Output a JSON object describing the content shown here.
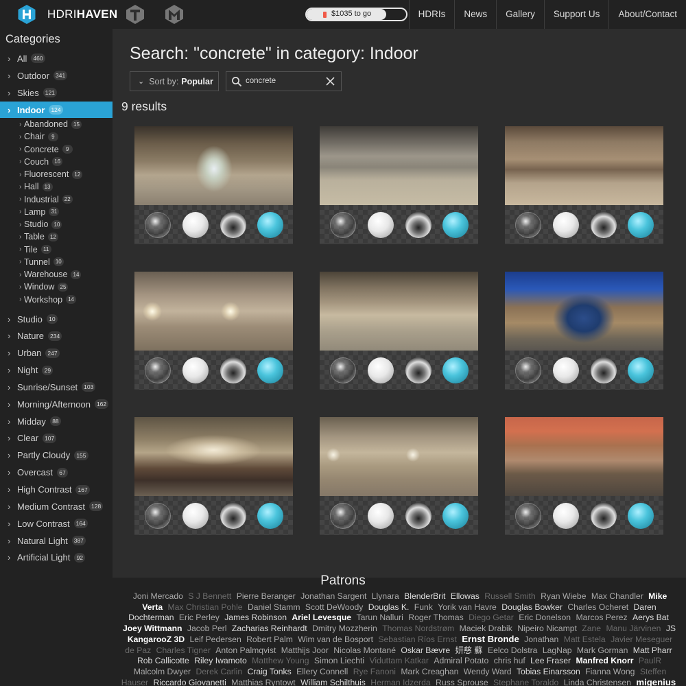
{
  "header": {
    "logo_light": "HDRI",
    "logo_bold_part": "HAVEN",
    "goal_text": "$1035 to go",
    "goal_progress": 0.8,
    "nav": [
      "HDRIs",
      "News",
      "Gallery",
      "Support Us",
      "About/Contact"
    ]
  },
  "sidebar": {
    "title": "Categories",
    "categories": [
      {
        "label": "All",
        "count": "460"
      },
      {
        "label": "Outdoor",
        "count": "341"
      },
      {
        "label": "Skies",
        "count": "121"
      },
      {
        "label": "Indoor",
        "count": "124"
      },
      {
        "label": "Studio",
        "count": "10"
      },
      {
        "label": "Nature",
        "count": "234"
      },
      {
        "label": "Urban",
        "count": "247"
      },
      {
        "label": "Night",
        "count": "29"
      },
      {
        "label": "Sunrise/Sunset",
        "count": "103"
      },
      {
        "label": "Morning/Afternoon",
        "count": "162"
      },
      {
        "label": "Midday",
        "count": "88"
      },
      {
        "label": "Clear",
        "count": "107"
      },
      {
        "label": "Partly Cloudy",
        "count": "155"
      },
      {
        "label": "Overcast",
        "count": "67"
      },
      {
        "label": "High Contrast",
        "count": "167"
      },
      {
        "label": "Medium Contrast",
        "count": "128"
      },
      {
        "label": "Low Contrast",
        "count": "164"
      },
      {
        "label": "Natural Light",
        "count": "387"
      },
      {
        "label": "Artificial Light",
        "count": "92"
      }
    ],
    "subcategories": [
      {
        "label": "Abandoned",
        "count": "15"
      },
      {
        "label": "Chair",
        "count": "9"
      },
      {
        "label": "Concrete",
        "count": "9"
      },
      {
        "label": "Couch",
        "count": "16"
      },
      {
        "label": "Fluorescent",
        "count": "12"
      },
      {
        "label": "Hall",
        "count": "13"
      },
      {
        "label": "Industrial",
        "count": "22"
      },
      {
        "label": "Lamp",
        "count": "31"
      },
      {
        "label": "Studio",
        "count": "10"
      },
      {
        "label": "Table",
        "count": "12"
      },
      {
        "label": "Tile",
        "count": "11"
      },
      {
        "label": "Tunnel",
        "count": "10"
      },
      {
        "label": "Warehouse",
        "count": "14"
      },
      {
        "label": "Window",
        "count": "25"
      },
      {
        "label": "Workshop",
        "count": "14"
      }
    ]
  },
  "main": {
    "heading": "Search: \"concrete\" in category: Indoor",
    "sort_prefix": "Sort by:",
    "sort_value": "Popular",
    "search_value": "concrete",
    "results_text": "9 results"
  },
  "patrons": {
    "title": "Patrons",
    "names": [
      {
        "n": "Joni Mercado",
        "t": 0
      },
      {
        "n": "S J Bennett",
        "t": 1
      },
      {
        "n": "Pierre Beranger",
        "t": 0
      },
      {
        "n": "Jonathan Sargent",
        "t": 0
      },
      {
        "n": "Llynara",
        "t": 0
      },
      {
        "n": "BlenderBrit",
        "t": 2
      },
      {
        "n": "Ellowas",
        "t": 2
      },
      {
        "n": "Russell Smith",
        "t": 1
      },
      {
        "n": "Ryan Wiebe",
        "t": 0
      },
      {
        "n": "Max Chandler",
        "t": 0
      },
      {
        "n": "Mike Verta",
        "t": 3
      },
      {
        "n": "Max Christian Pohle",
        "t": 1
      },
      {
        "n": "Daniel Stamm",
        "t": 0
      },
      {
        "n": "Scott DeWoody",
        "t": 0
      },
      {
        "n": "Douglas K.",
        "t": 2
      },
      {
        "n": "Funk",
        "t": 0
      },
      {
        "n": "Yorik van Havre",
        "t": 0
      },
      {
        "n": "Douglas Bowker",
        "t": 2
      },
      {
        "n": "Charles Ocheret",
        "t": 0
      },
      {
        "n": "Daren Dochterman",
        "t": 2
      },
      {
        "n": "Eric Perley",
        "t": 0
      },
      {
        "n": "James Robinson",
        "t": 2
      },
      {
        "n": "Ariel Levesque",
        "t": 3
      },
      {
        "n": "Tarun Nalluri",
        "t": 0
      },
      {
        "n": "Roger Thomas",
        "t": 0
      },
      {
        "n": "Diego Getar",
        "t": 1
      },
      {
        "n": "Eric Donelson",
        "t": 0
      },
      {
        "n": "Marcos Perez",
        "t": 0
      },
      {
        "n": "Aerys Bat",
        "t": 2
      },
      {
        "n": "Joey Wittmann",
        "t": 3
      },
      {
        "n": "Jacob Perl",
        "t": 0
      },
      {
        "n": "Zacharias Reinhardt",
        "t": 2
      },
      {
        "n": "Dmitry Mozzherin",
        "t": 0
      },
      {
        "n": "Thomas Nordstrøm",
        "t": 1
      },
      {
        "n": "Maciek Drabik",
        "t": 0
      },
      {
        "n": "Nipeiro Nicampt",
        "t": 0
      },
      {
        "n": "Zane",
        "t": 1
      },
      {
        "n": "Manu Järvinen",
        "t": 1
      },
      {
        "n": "JS",
        "t": 2
      },
      {
        "n": "KangarooZ 3D",
        "t": 3
      },
      {
        "n": "Leif Pedersen",
        "t": 0
      },
      {
        "n": "Robert Palm",
        "t": 0
      },
      {
        "n": "Wim van de Bosport",
        "t": 0
      },
      {
        "n": "Sebastian Ríos Ernst",
        "t": 1
      },
      {
        "n": "Ernst Bronde",
        "t": 4
      },
      {
        "n": "Jonathan",
        "t": 0
      },
      {
        "n": "Matt Estela",
        "t": 1
      },
      {
        "n": "Javier Meseguer de Paz",
        "t": 1
      },
      {
        "n": "Charles Tigner",
        "t": 1
      },
      {
        "n": "Anton Palmqvist",
        "t": 0
      },
      {
        "n": "Matthijs Joor",
        "t": 0
      },
      {
        "n": "Nicolas Montané",
        "t": 0
      },
      {
        "n": "Oskar Bævre",
        "t": 2
      },
      {
        "n": "妍慈 蘇",
        "t": 2
      },
      {
        "n": "Eelco Dolstra",
        "t": 0
      },
      {
        "n": "LagNap",
        "t": 0
      },
      {
        "n": "Mark Gorman",
        "t": 0
      },
      {
        "n": "Matt Pharr",
        "t": 2
      },
      {
        "n": "Rob Callicotte",
        "t": 2
      },
      {
        "n": "Riley Iwamoto",
        "t": 2
      },
      {
        "n": "Matthew Young",
        "t": 1
      },
      {
        "n": "Simon Liechti",
        "t": 0
      },
      {
        "n": "Viduttam Katkar",
        "t": 1
      },
      {
        "n": "Admiral Potato",
        "t": 0
      },
      {
        "n": "chris huf",
        "t": 0
      },
      {
        "n": "Lee Fraser",
        "t": 2
      },
      {
        "n": "Manfred Knorr",
        "t": 3
      },
      {
        "n": "PaulR",
        "t": 1
      },
      {
        "n": "Malcolm Dwyer",
        "t": 0
      },
      {
        "n": "Derek Carlin",
        "t": 1
      },
      {
        "n": "Craig Tonks",
        "t": 2
      },
      {
        "n": "Ellery Connell",
        "t": 0
      },
      {
        "n": "Rye Fanoni",
        "t": 1
      },
      {
        "n": "Mark Creaghan",
        "t": 0
      },
      {
        "n": "Wendy Ward",
        "t": 0
      },
      {
        "n": "Tobias Einarsson",
        "t": 2
      },
      {
        "n": "Fianna Wong",
        "t": 0
      },
      {
        "n": "Steffen Hauser",
        "t": 1
      },
      {
        "n": "Riccardo Giovanetti",
        "t": 2
      },
      {
        "n": "Matthias Ryntowt",
        "t": 0
      },
      {
        "n": "William Schilthuis",
        "t": 2
      },
      {
        "n": "Herman Idzerda",
        "t": 1
      },
      {
        "n": "Russ Sprouse",
        "t": 0
      },
      {
        "n": "Stephane Toraldo",
        "t": 1
      },
      {
        "n": "Linda Christensen",
        "t": 0
      },
      {
        "n": "migenius",
        "t": 4
      }
    ]
  }
}
